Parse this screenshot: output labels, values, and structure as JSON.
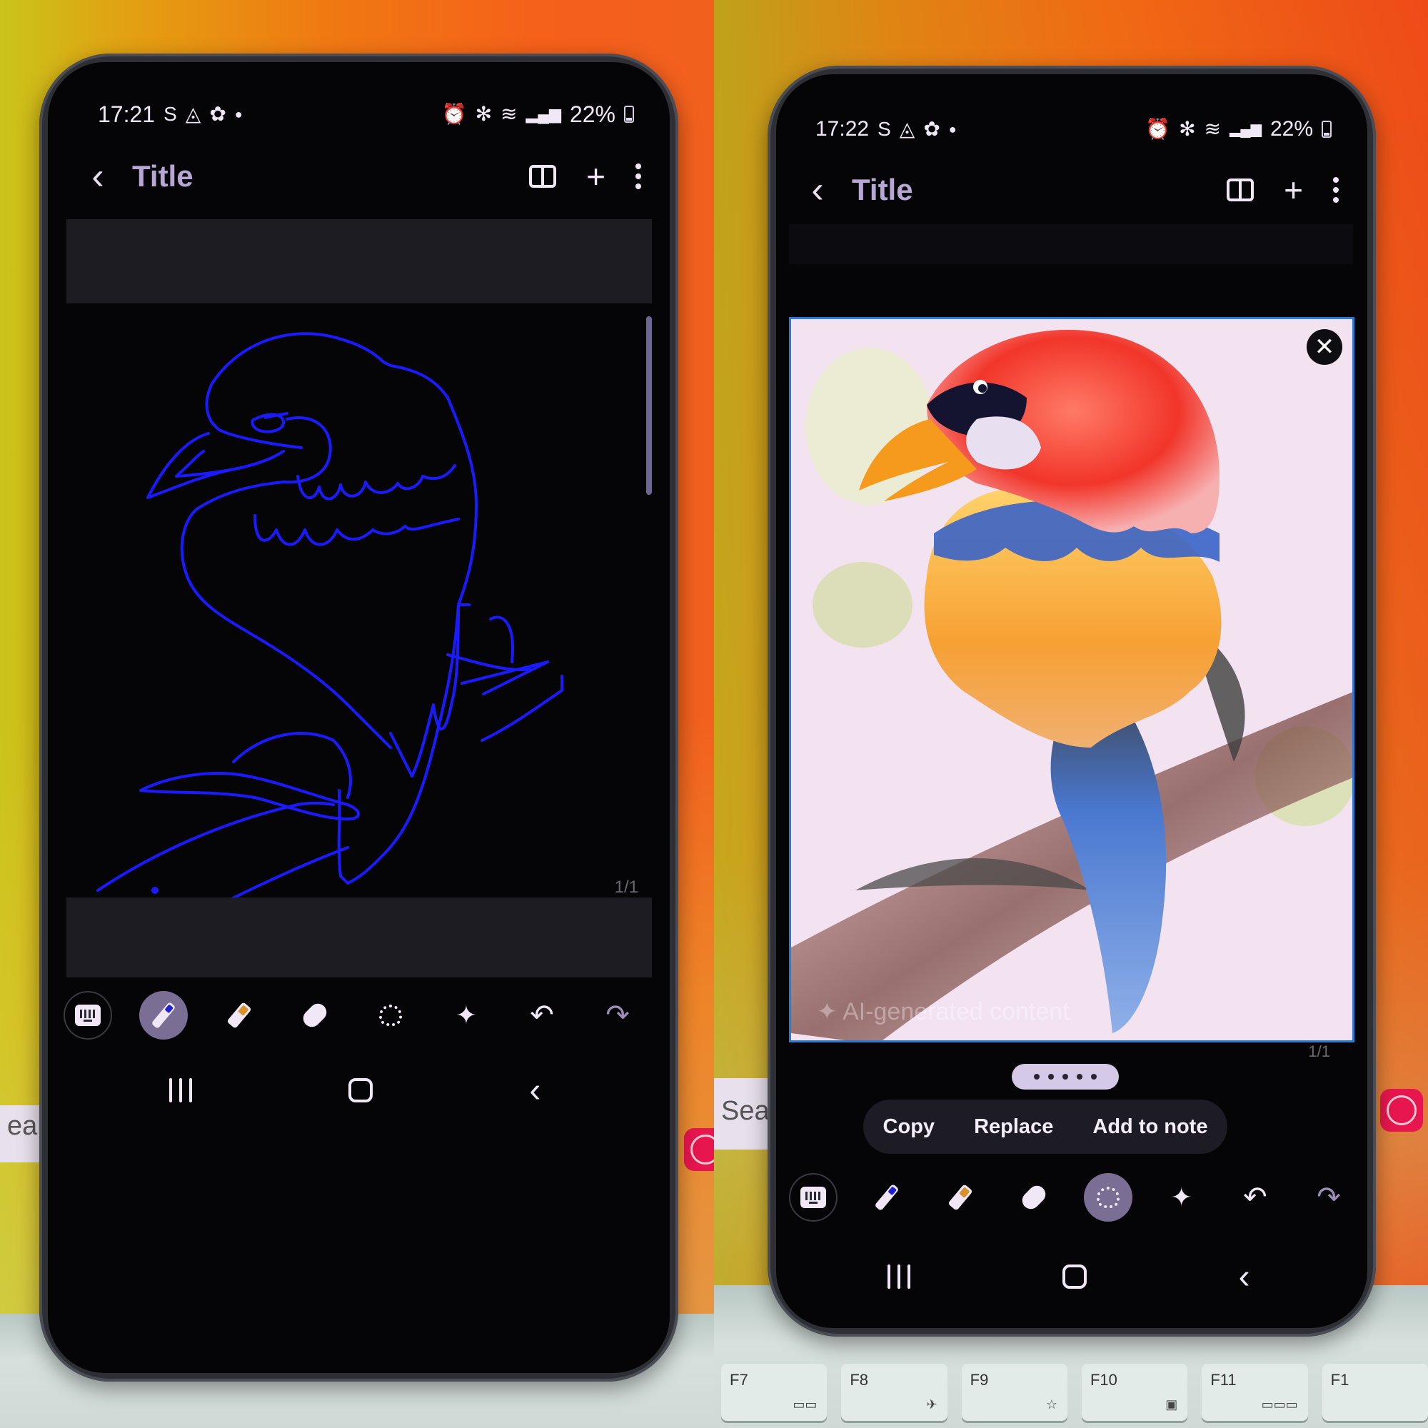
{
  "background": {
    "left_search_text": "earc",
    "right_search_text": "Searc",
    "keyboard_keys": [
      {
        "label": "F7",
        "icon": "display-toggle-icon"
      },
      {
        "label": "F8",
        "icon": "airplane-icon"
      },
      {
        "label": "F9",
        "icon": "star-brightness-icon"
      },
      {
        "label": "F10",
        "icon": "screen-icon"
      },
      {
        "label": "F11",
        "icon": "keyboard-backlight-icon"
      },
      {
        "label": "F1",
        "icon": ""
      }
    ]
  },
  "left_phone": {
    "status": {
      "time": "17:21",
      "battery": "22%",
      "battery_level": 0.22
    },
    "appbar": {
      "title": "Title",
      "back_glyph": "‹",
      "plus_glyph": "+"
    },
    "drawing": {
      "stroke_color": "#1a1aff"
    },
    "page_counter": "1/1",
    "toolbar": {
      "active_tool": "pen",
      "tools": [
        "keyboard",
        "pen",
        "highlighter",
        "eraser",
        "lasso",
        "ai-assist",
        "undo",
        "redo"
      ],
      "undo_glyph": "↶",
      "redo_glyph": "↷",
      "sparkle_glyph": "✦"
    },
    "navbar": {
      "back_glyph": "‹"
    }
  },
  "right_phone": {
    "status": {
      "time": "17:22",
      "battery": "22%",
      "battery_level": 0.22
    },
    "appbar": {
      "title": "Title",
      "back_glyph": "‹",
      "plus_glyph": "+"
    },
    "generated_image": {
      "label": "AI-generated content",
      "close_glyph": "✕",
      "description": "Watercolor bird with red head, blue and yellow plumage perched on a branch"
    },
    "page_counter": "1/1",
    "actions": [
      "Copy",
      "Replace",
      "Add to note"
    ],
    "toolbar": {
      "active_tool": "lasso",
      "tools": [
        "keyboard",
        "pen",
        "highlighter",
        "eraser",
        "lasso",
        "ai-assist",
        "undo",
        "redo"
      ],
      "undo_glyph": "↶",
      "redo_glyph": "↷",
      "sparkle_glyph": "✦"
    },
    "navbar": {
      "back_glyph": "‹"
    }
  }
}
